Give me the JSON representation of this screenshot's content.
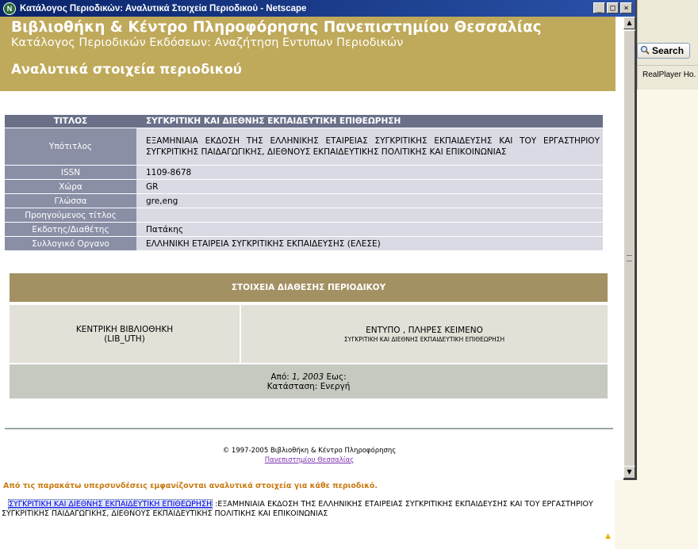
{
  "window": {
    "title": "Κατάλογος Περιοδικών: Αναλυτικά Στοιχεία Περιοδικού - Netscape",
    "app_icon": "netscape-icon",
    "controls": {
      "minimize": "_",
      "maximize": "□",
      "close": "×"
    }
  },
  "background_browser": {
    "search_label": "Search",
    "realplayer_label": "RealPlayer Ho.",
    "note": "Από τις παρακάτω υπερσυνδέσεις εμφανίζονται αναλυτικά στοιχεία για κάθε περιοδικό.",
    "entry_link": "ΣΥΓΚΡΙΤΙΚΗ ΚΑΙ ΔΙΕΘΝΗΣ ΕΚΠΑΙΔΕΥΤΙΚΗ ΕΠΙΘΕΩΡΗΣΗ",
    "entry_text": " :ΕΞΑΜΗΝΙΑΙΑ ΕΚΔΟΣΗ ΤΗΣ ΕΛΛΗΝΙΚΗΣ ΕΤΑΙΡΕΙΑΣ ΣΥΓΚΡΙΤΙΚΗΣ ΕΚΠΑΙΔΕΥΣΗΣ ΚΑΙ ΤΟΥ ΕΡΓΑΣΤΗΡΙΟΥ ΣΥΓΚΡΙΤΙΚΗΣ ΠΑΙΔΑΓΩΓΙΚΗΣ, ΔΙΕΘΝΟΥΣ ΕΚΠΑΙΔΕΥΤΙΚΗΣ ΠΟΛΙΤΙΚΗΣ ΚΑΙ ΕΠΙΚΟΙΝΩΝΙΑΣ"
  },
  "header": {
    "library": "Βιβλιοθήκη & Κέντρο Πληροφόρησης Πανεπιστημίου Θεσσαλίας",
    "catalog": "Κατάλογος Περιοδικών Εκδόσεων: Αναζήτηση Εντυπων Περιοδικών",
    "details_title": "Αναλυτικά στοιχεία περιοδικού"
  },
  "record": {
    "title_label": "ΤΙΤΛΟΣ",
    "title_value": "ΣΥΓΚΡΙΤΙΚΗ ΚΑΙ ΔΙΕΘΝΗΣ ΕΚΠΑΙΔΕΥΤΙΚΗ ΕΠΙΘΕΩΡΗΣΗ",
    "subtitle_label": "Υπότιτλος",
    "subtitle_value": "ΕΞΑΜΗΝΙΑΙΑ ΕΚΔΟΣΗ ΤΗΣ ΕΛΛΗΝΙΚΗΣ ΕΤΑΙΡΕΙΑΣ ΣΥΓΚΡΙΤΙΚΗΣ ΕΚΠΑΙΔΕΥΣΗΣ ΚΑΙ ΤΟΥ ΕΡΓΑΣΤΗΡΙΟΥ ΣΥΓΚΡΙΤΙΚΗΣ ΠΑΙΔΑΓΩΓΙΚΗΣ, ΔΙΕΘΝΟΥΣ ΕΚΠΑΙΔΕΥΤΙΚΗΣ ΠΟΛΙΤΙΚΗΣ ΚΑΙ ΕΠΙΚΟΙΝΩΝΙΑΣ",
    "issn_label": "ISSN",
    "issn_value": "1109-8678",
    "country_label": "Χώρα",
    "country_value": "GR",
    "language_label": "Γλώσσα",
    "language_value": "gre,eng",
    "prev_title_label": "Προηγούμενος τίτλος",
    "prev_title_value": "",
    "publisher_label": "Εκδοτης/Διαθέτης",
    "publisher_value": "Πατάκης",
    "corporate_label": "Συλλογικό Οργανο",
    "corporate_value": "ΕΛΛΗΝΙΚΗ ΕΤΑΙΡΕΙΑ ΣΥΓΚΡΙΤΙΚΗΣ ΕΚΠΑΙΔΕΥΣΗΣ (ΕΛΕΣΕ)"
  },
  "availability": {
    "heading": "ΣΤΟΙΧΕΙΑ ΔΙΑΘΕΣΗΣ ΠΕΡΙΟΔΙΚΟΥ",
    "library_name": "ΚΕΝΤΡΙΚΗ ΒΙΒΛΙΟΘΗΚΗ",
    "library_code": "(LIB_UTH)",
    "format": "ΕΝΤΥΠΟ , ΠΛΗΡΕΣ ΚΕΙΜΕΝΟ",
    "format_title": "ΣΥΓΚΡΙΤΙΚΗ ΚΑΙ ΔΙΕΘΝΗΣ ΕΚΠΑΙΔΕΥΤΙΚΗ ΕΠΙΘΕΩΡΗΣΗ",
    "from_label": "Από:",
    "from_value": "1, 2003",
    "to_label": "Εως:",
    "status": "Κατάσταση: Ενεργή"
  },
  "footer": {
    "copyright": "© 1997-2005 Βιβλιοθήκη & Κέντρο Πληροφόρησης",
    "university_link": "Πανεπιστημίου Θεσσαλίας"
  },
  "colors": {
    "header_bg": "#bfa95a",
    "titlebar": "#0a246a",
    "label_bg": "#8a8fa6",
    "value_bg": "#d9dae3",
    "availability_head": "#a39063"
  }
}
